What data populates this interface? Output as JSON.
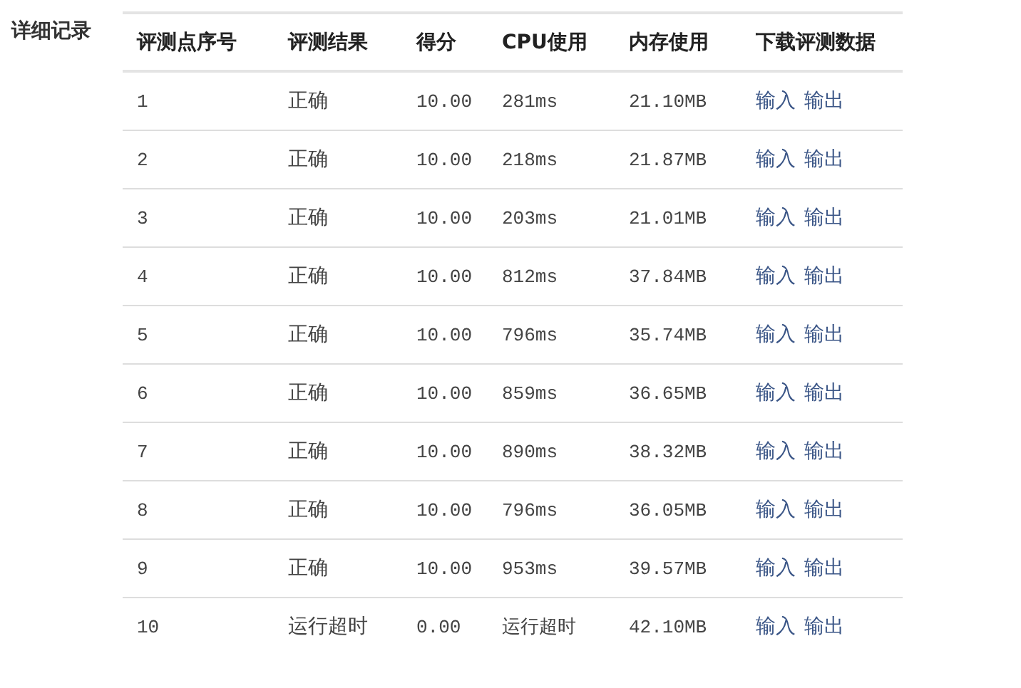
{
  "section_label": "详细记录",
  "table": {
    "columns": [
      "评测点序号",
      "评测结果",
      "得分",
      "CPU使用",
      "内存使用",
      "下载评测数据"
    ],
    "rows": [
      {
        "index": "1",
        "result": "正确",
        "score": "10.00",
        "cpu": "281ms",
        "memory": "21.10MB",
        "links": [
          "输入",
          "输出"
        ]
      },
      {
        "index": "2",
        "result": "正确",
        "score": "10.00",
        "cpu": "218ms",
        "memory": "21.87MB",
        "links": [
          "输入",
          "输出"
        ]
      },
      {
        "index": "3",
        "result": "正确",
        "score": "10.00",
        "cpu": "203ms",
        "memory": "21.01MB",
        "links": [
          "输入",
          "输出"
        ]
      },
      {
        "index": "4",
        "result": "正确",
        "score": "10.00",
        "cpu": "812ms",
        "memory": "37.84MB",
        "links": [
          "输入",
          "输出"
        ]
      },
      {
        "index": "5",
        "result": "正确",
        "score": "10.00",
        "cpu": "796ms",
        "memory": "35.74MB",
        "links": [
          "输入",
          "输出"
        ]
      },
      {
        "index": "6",
        "result": "正确",
        "score": "10.00",
        "cpu": "859ms",
        "memory": "36.65MB",
        "links": [
          "输入",
          "输出"
        ]
      },
      {
        "index": "7",
        "result": "正确",
        "score": "10.00",
        "cpu": "890ms",
        "memory": "38.32MB",
        "links": [
          "输入",
          "输出"
        ]
      },
      {
        "index": "8",
        "result": "正确",
        "score": "10.00",
        "cpu": "796ms",
        "memory": "36.05MB",
        "links": [
          "输入",
          "输出"
        ]
      },
      {
        "index": "9",
        "result": "正确",
        "score": "10.00",
        "cpu": "953ms",
        "memory": "39.57MB",
        "links": [
          "输入",
          "输出"
        ]
      },
      {
        "index": "10",
        "result": "运行超时",
        "score": "0.00",
        "cpu": "运行超时",
        "memory": "42.10MB",
        "links": [
          "输入",
          "输出"
        ]
      }
    ]
  }
}
